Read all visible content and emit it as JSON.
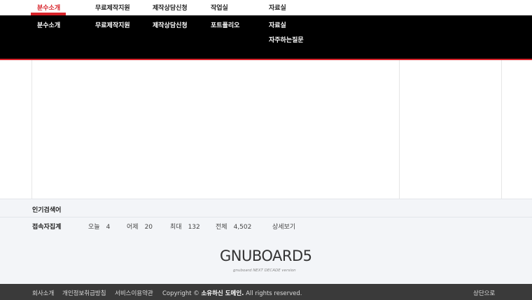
{
  "nav": {
    "items": [
      "분수소개",
      "무료제작지원",
      "제작상담신청",
      "작업실",
      "자료실"
    ],
    "active_index": 0
  },
  "dropdown": {
    "items": [
      "분수소개",
      "무료제작지원",
      "제작상담신청",
      "포트폴리오",
      "자료실",
      "자주하는질문"
    ]
  },
  "stats": {
    "popular_title": "인기검색어",
    "visit_title": "접속자집계",
    "today_label": "오늘",
    "today_value": "4",
    "yesterday_label": "어제",
    "yesterday_value": "20",
    "max_label": "최대",
    "max_value": "132",
    "total_label": "전체",
    "total_value": "4,502",
    "detail_label": "상세보기"
  },
  "logo": {
    "title": "GNUBOARD5",
    "subtitle": "gnuboard NEXT DECADE version"
  },
  "footer": {
    "links": [
      "회사소개",
      "개인정보취급방침",
      "서비스이용약관"
    ],
    "copyright_prefix": "Copyright ©",
    "copyright_name": "소유하신 도메인.",
    "copyright_suffix": "All rights reserved.",
    "top_label": "상단으로"
  },
  "colors": {
    "accent": "#d8232a",
    "dropdown_bg": "#000000",
    "footer_bg": "#3a3a3a",
    "band_bg": "#f3f5f8"
  }
}
